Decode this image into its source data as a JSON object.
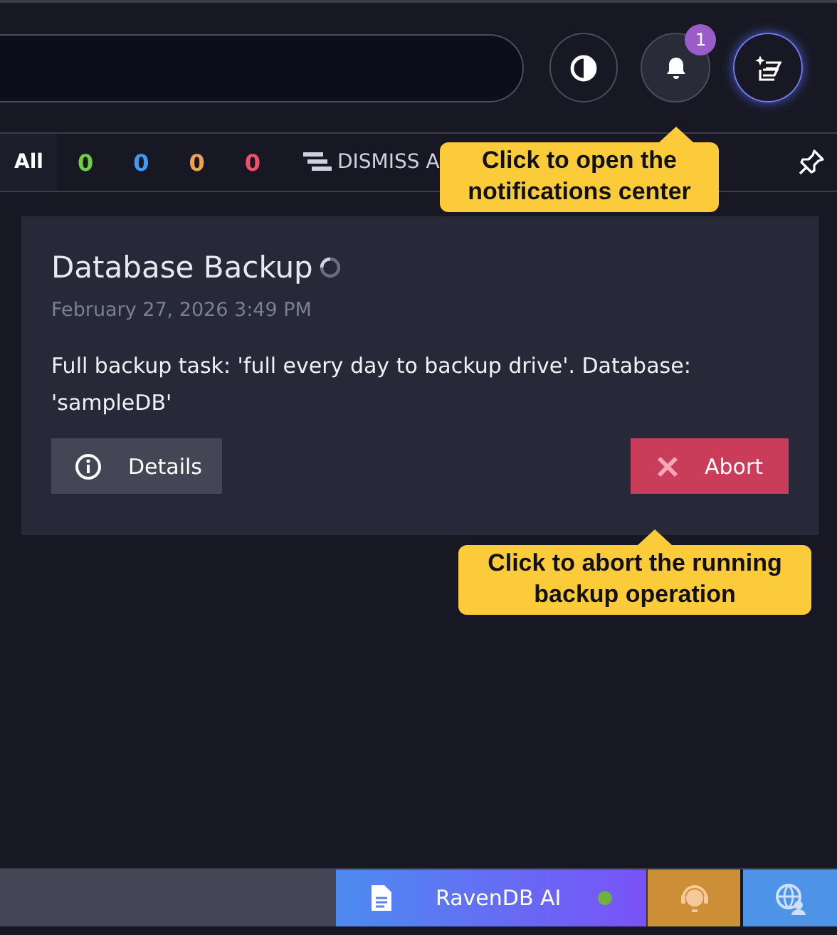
{
  "header": {
    "notification_count": "1"
  },
  "filters": [
    {
      "label": "All",
      "kind": "text",
      "selected": true
    },
    {
      "label": "0",
      "kind": "count",
      "color": "#6fcf3f",
      "selected": false
    },
    {
      "label": "0",
      "kind": "count",
      "color": "#3d9cf5",
      "selected": false
    },
    {
      "label": "0",
      "kind": "count",
      "color": "#f0a050",
      "selected": false
    },
    {
      "label": "0",
      "kind": "count",
      "color": "#f0506a",
      "selected": false
    }
  ],
  "dismiss_label": "DISMISS A",
  "notification": {
    "title": "Database Backup",
    "time": "February 27, 2026 3:49 PM",
    "message": "Full backup task: 'full every day to backup drive'. Database: 'sampleDB'",
    "buttons": [
      {
        "label": "Details",
        "kind": "details"
      },
      {
        "label": "Abort",
        "kind": "abort"
      }
    ]
  },
  "tooltips": [
    {
      "text": "Click to open the notifications center",
      "kind": "bell"
    },
    {
      "text": "Click to abort the running backup operation",
      "kind": "abort"
    }
  ],
  "footer": {
    "ai_label": "RavenDB AI",
    "ai_online": true
  }
}
